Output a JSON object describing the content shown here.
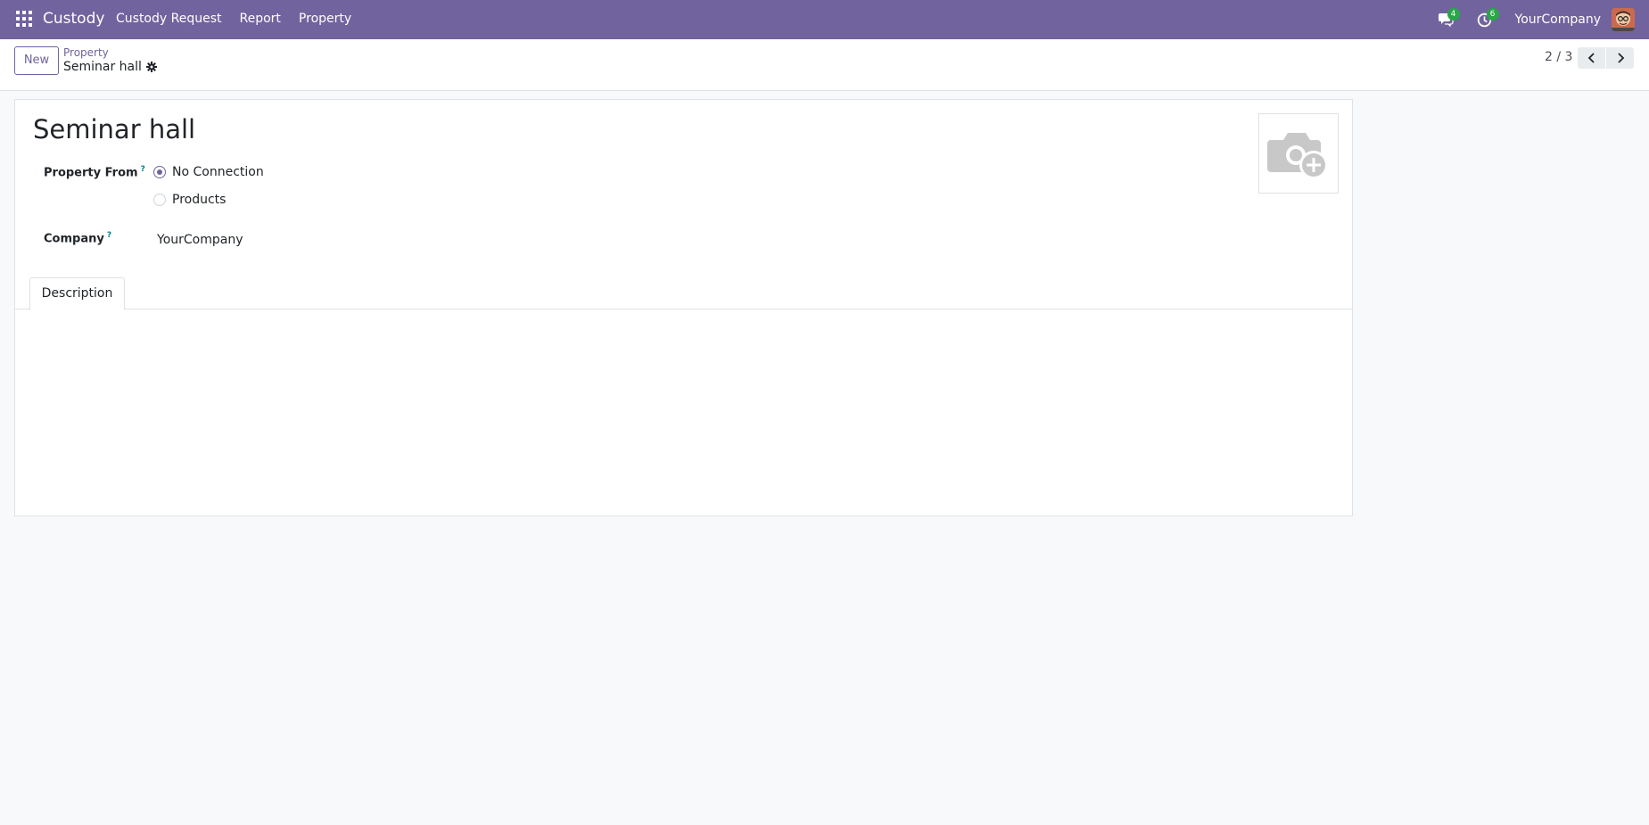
{
  "navbar": {
    "app_name": "Custody",
    "menu": [
      "Custody Request",
      "Report",
      "Property"
    ],
    "messages_count": "4",
    "activities_count": "6",
    "company": "YourCompany",
    "bg_color": "#71639e"
  },
  "control_panel": {
    "new_label": "New",
    "breadcrumb_parent": "Property",
    "breadcrumb_current": "Seminar hall",
    "pager": "2 / 3"
  },
  "form": {
    "title": "Seminar hall",
    "property_from_label": "Property From",
    "property_from_help": "?",
    "property_from_options": [
      "No Connection",
      "Products"
    ],
    "property_from_selected": "No Connection",
    "company_label": "Company",
    "company_help": "?",
    "company_value": "YourCompany",
    "tabs": [
      "Description"
    ]
  },
  "icons": {
    "apps": "grid-icon",
    "messages": "chat-icon",
    "activities": "clock-icon",
    "gear": "gear-icon",
    "prev": "chevron-left-icon",
    "next": "chevron-right-icon",
    "image": "camera-plus-icon"
  }
}
